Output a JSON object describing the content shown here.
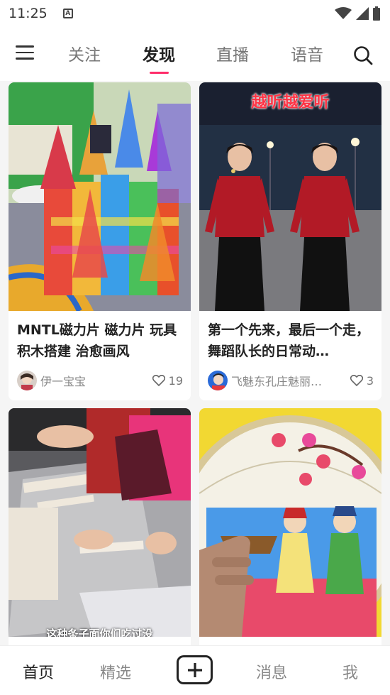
{
  "status_bar": {
    "time": "11:25",
    "notification": "A"
  },
  "top_nav": {
    "tabs": [
      {
        "label": "关注",
        "active": false
      },
      {
        "label": "发现",
        "active": true
      },
      {
        "label": "直播",
        "active": false
      },
      {
        "label": "语音",
        "active": false
      }
    ],
    "accent_color": "#ff2d6a"
  },
  "feed": [
    {
      "title": "MNTL磁力片 磁力片 玩具 积木搭建 治愈画风",
      "author": "伊一宝宝",
      "likes": "19"
    },
    {
      "title": "第一个先来，最后一个走，舞蹈队长的日常动…",
      "author": "飞魅东孔庄魅丽…",
      "likes": "3",
      "image_caption": "越听越爱听"
    },
    {
      "image_caption": "这种条子面你们吃过没"
    },
    {}
  ],
  "bottom_nav": {
    "items": [
      {
        "label": "首页",
        "active": true
      },
      {
        "label": "精选",
        "active": false
      },
      {
        "label": "消息",
        "active": false
      },
      {
        "label": "我",
        "active": false
      }
    ]
  }
}
